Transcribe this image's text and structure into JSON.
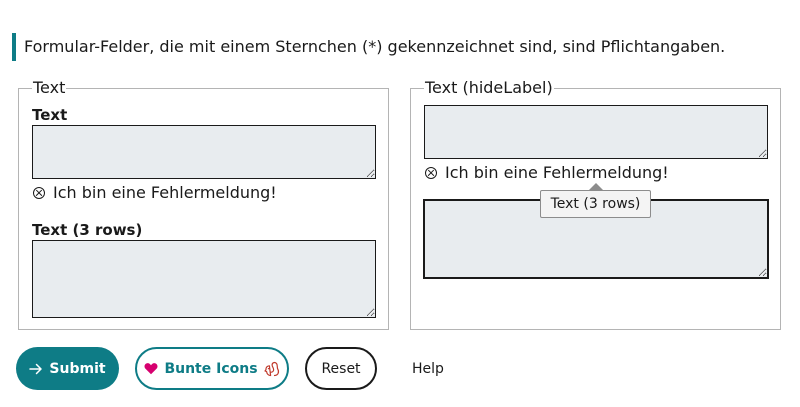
{
  "notice": "Formular-Felder, die mit einem Sternchen (*) gekennzeichnet sind, sind Pflichtangaben.",
  "left_group": {
    "legend": "Text",
    "field1_label": "Text",
    "field1_error": "Ich bin eine Fehlermeldung!",
    "field2_label": "Text (3 rows)"
  },
  "right_group": {
    "legend": "Text (hideLabel)",
    "field1_error": "Ich bin eine Fehlermeldung!",
    "tooltip": "Text (3 rows)"
  },
  "buttons": {
    "submit": "Submit",
    "colorful": "Bunte Icons",
    "reset": "Reset",
    "help": "Help"
  },
  "icons": {
    "submit": "arrow-right-icon",
    "colorful_left": "heart-icon",
    "colorful_right": "squirrel-icon",
    "error": "error-x-circle-icon"
  },
  "colors": {
    "accent": "#0e7c86",
    "heart": "#d6006f",
    "squirrel": "#c0392b",
    "field_bg": "#e8ecef"
  }
}
